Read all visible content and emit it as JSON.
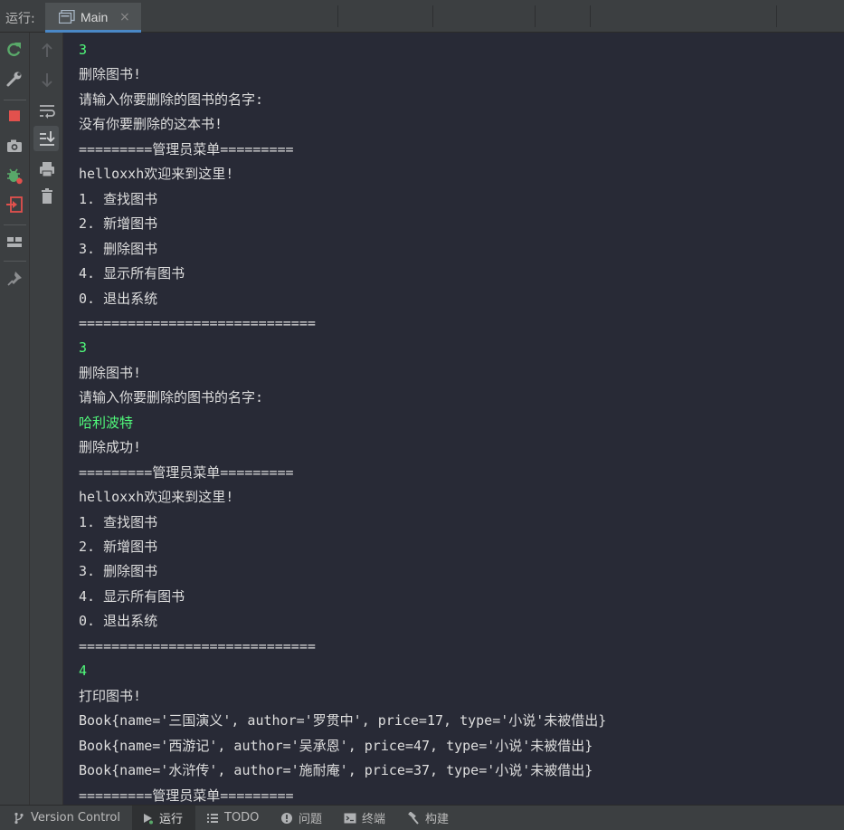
{
  "tabbar": {
    "run_label": "运行:",
    "active_tab": {
      "label": "Main",
      "icon": "console-window-icon",
      "close": "×"
    }
  },
  "toolbar_left": {
    "buttons": [
      "rerun-icon",
      "wrench-icon",
      "stop-icon",
      "camera-icon",
      "debug-bug-icon",
      "exit-icon",
      "layout-icon",
      "pin-icon"
    ]
  },
  "toolbar_right": {
    "buttons": [
      "arrow-up-icon",
      "arrow-down-icon",
      "soft-wrap-icon",
      "scroll-to-end-icon",
      "print-icon",
      "trash-icon"
    ]
  },
  "console": {
    "lines": [
      {
        "text": "3",
        "kind": "input"
      },
      {
        "text": "删除图书!",
        "kind": "output"
      },
      {
        "text": "请输入你要删除的图书的名字:",
        "kind": "output"
      },
      {
        "text": "没有你要删除的这本书!",
        "kind": "output"
      },
      {
        "text": "=========管理员菜单=========",
        "kind": "output"
      },
      {
        "text": "helloxxh欢迎来到这里!",
        "kind": "output"
      },
      {
        "text": "1. 查找图书",
        "kind": "output"
      },
      {
        "text": "2. 新增图书",
        "kind": "output"
      },
      {
        "text": "3. 删除图书",
        "kind": "output"
      },
      {
        "text": "4. 显示所有图书",
        "kind": "output"
      },
      {
        "text": "0. 退出系统",
        "kind": "output"
      },
      {
        "text": "=============================",
        "kind": "output"
      },
      {
        "text": "3",
        "kind": "input"
      },
      {
        "text": "删除图书!",
        "kind": "output"
      },
      {
        "text": "请输入你要删除的图书的名字:",
        "kind": "output"
      },
      {
        "text": "哈利波特",
        "kind": "input"
      },
      {
        "text": "删除成功!",
        "kind": "output"
      },
      {
        "text": "=========管理员菜单=========",
        "kind": "output"
      },
      {
        "text": "helloxxh欢迎来到这里!",
        "kind": "output"
      },
      {
        "text": "1. 查找图书",
        "kind": "output"
      },
      {
        "text": "2. 新增图书",
        "kind": "output"
      },
      {
        "text": "3. 删除图书",
        "kind": "output"
      },
      {
        "text": "4. 显示所有图书",
        "kind": "output"
      },
      {
        "text": "0. 退出系统",
        "kind": "output"
      },
      {
        "text": "=============================",
        "kind": "output"
      },
      {
        "text": "4",
        "kind": "input"
      },
      {
        "text": "打印图书!",
        "kind": "output"
      },
      {
        "text": "Book{name='三国演义', author='罗贯中', price=17, type='小说'未被借出}",
        "kind": "output"
      },
      {
        "text": "Book{name='西游记', author='吴承恩', price=47, type='小说'未被借出}",
        "kind": "output"
      },
      {
        "text": "Book{name='水浒传', author='施耐庵', price=37, type='小说'未被借出}",
        "kind": "output"
      },
      {
        "text": "=========管理员菜单=========",
        "kind": "output"
      }
    ]
  },
  "bottombar": {
    "items": [
      {
        "label": "Version Control",
        "icon": "branch-icon",
        "active": false
      },
      {
        "label": "运行",
        "icon": "run-play-icon",
        "active": true
      },
      {
        "label": "TODO",
        "icon": "todo-list-icon",
        "active": false
      },
      {
        "label": "问题",
        "icon": "problems-icon",
        "active": false
      },
      {
        "label": "终端",
        "icon": "terminal-icon",
        "active": false
      },
      {
        "label": "构建",
        "icon": "hammer-icon",
        "active": false
      }
    ]
  },
  "colors": {
    "input_text": "#50fa7b",
    "output_text": "#dedede",
    "console_bg": "#282a36",
    "chrome_bg": "#3c3f41",
    "tab_accent": "#4a88c7"
  }
}
